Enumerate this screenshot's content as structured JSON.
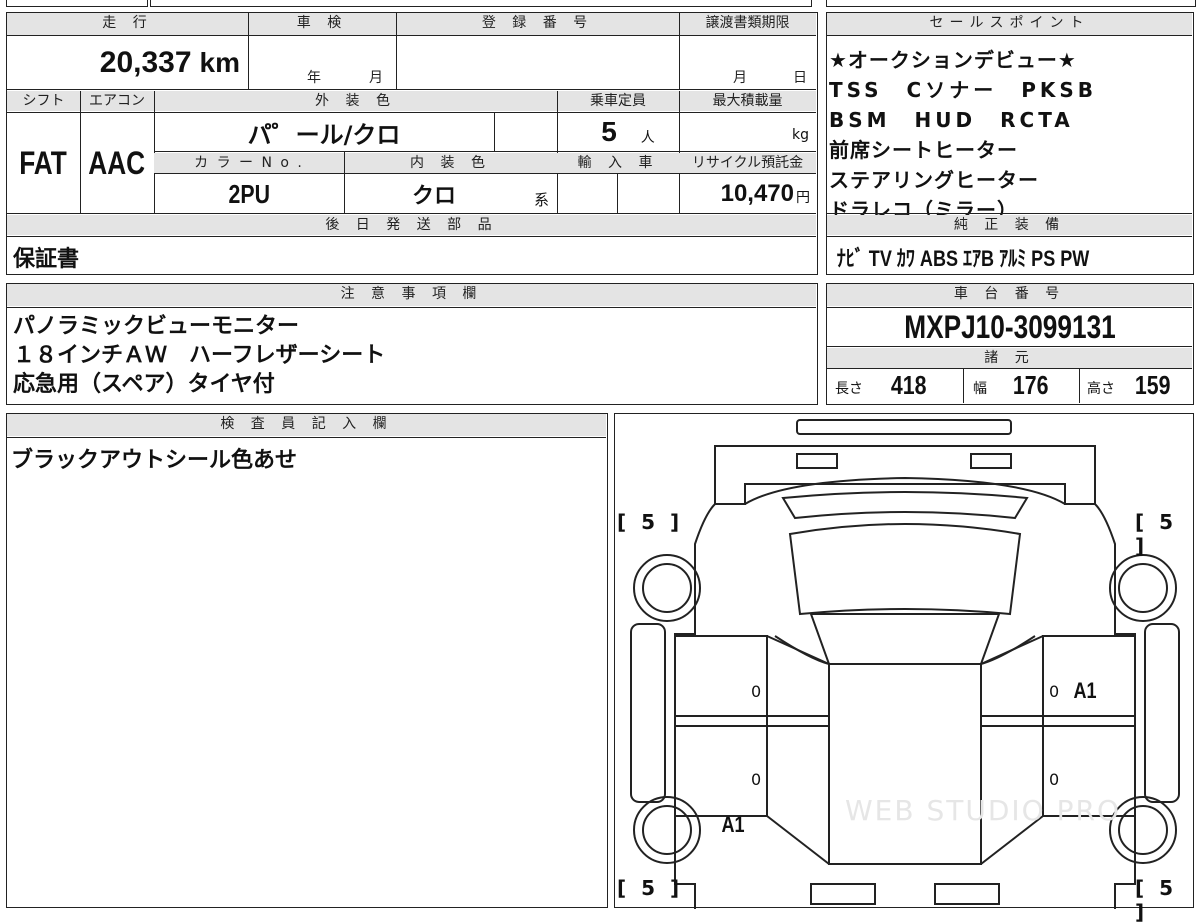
{
  "mileage": {
    "header": "走 行",
    "value": "20,337",
    "unit": "km"
  },
  "inspection": {
    "header": "車 検",
    "year_label": "年",
    "month_label": "月"
  },
  "registration": {
    "header": "登 録 番 号"
  },
  "transfer_deadline": {
    "header": "譲渡書類期限",
    "month_label": "月",
    "day_label": "日"
  },
  "shift": {
    "header": "シフト",
    "value": "FAT"
  },
  "aircon": {
    "header": "エアコン",
    "value": "AAC"
  },
  "exterior_color": {
    "header": "外 装 色",
    "value": "パ゜ール/クロ"
  },
  "capacity": {
    "header": "乗車定員",
    "value": "5",
    "unit": "人"
  },
  "max_load": {
    "header": "最大積載量",
    "unit": "kg"
  },
  "color_no": {
    "header": "カ ラ ー N o .",
    "value": "2PU"
  },
  "interior_color": {
    "header": "内 装 色",
    "value": "クロ",
    "suffix": "系"
  },
  "import": {
    "header": "輸 入 車"
  },
  "recycle_fee": {
    "header": "リサイクル預託金",
    "value": "10,470",
    "unit": "円"
  },
  "later_parts": {
    "header": "後 日 発 送 部 品",
    "value": "保証書"
  },
  "sales_points": {
    "header": "セールスポイント",
    "lines": [
      "★オークションデビュー★",
      "TSS　Cソナー　PKSB",
      "BSM　HUD　RCTA",
      "前席シートヒーター",
      "ステアリングヒーター",
      "ドラレコ（ミラー）"
    ]
  },
  "oem_equipment": {
    "header": "純 正 装 備",
    "value": "ﾅﾋﾞ TV ｶﾜ ABS ｴｱB ｱﾙﾐ PS PW"
  },
  "notes": {
    "header": "注 意 事 項 欄",
    "lines": [
      "パノラミックビューモニター",
      "１８インチＡＷ　ハーフレザーシート",
      "応急用（スペア）タイヤ付"
    ]
  },
  "chassis": {
    "header": "車 台 番 号",
    "value": "MXPJ10-3099131"
  },
  "specs": {
    "header": "諸 元",
    "length_label": "長さ",
    "length": "418",
    "width_label": "幅",
    "width": "176",
    "height_label": "高さ",
    "height": "159"
  },
  "inspector": {
    "header": "検 査 員 記 入 欄",
    "value": "ブラックアウトシール色あせ"
  },
  "diagram": {
    "tire_tl": "[ 5 ]",
    "tire_tr": "[ 5 ]",
    "tire_bl": "[ 5 ]",
    "tire_br": "[ 5 ]",
    "mark_right_front": "A1",
    "mark_left_rear": "A1",
    "zero_1": "0",
    "zero_2": "0",
    "zero_3": "0",
    "zero_4": "0",
    "watermark": "WEB STUDIO PRO"
  }
}
